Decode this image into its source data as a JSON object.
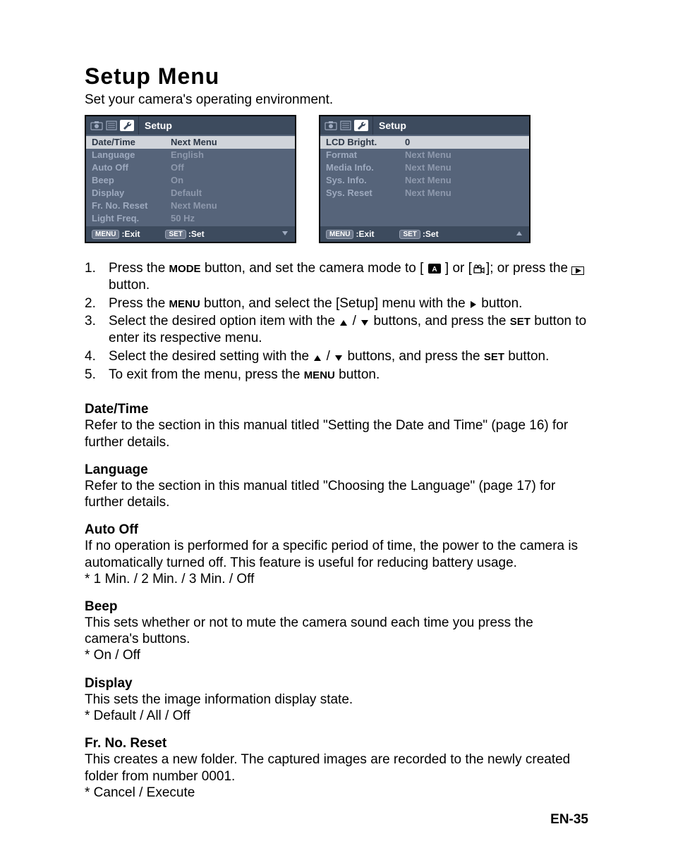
{
  "title": "Setup Menu",
  "intro": "Set your camera's operating environment.",
  "osd1": {
    "setup_label": "Setup",
    "rows": [
      {
        "label": "Date/Time",
        "value": "Next Menu",
        "highlight": true
      },
      {
        "label": "Language",
        "value": "English"
      },
      {
        "label": "Auto Off",
        "value": "Off"
      },
      {
        "label": "Beep",
        "value": "On"
      },
      {
        "label": "Display",
        "value": "Default"
      },
      {
        "label": "Fr. No. Reset",
        "value": "Next Menu"
      },
      {
        "label": "Light Freq.",
        "value": "50 Hz"
      }
    ],
    "footer_exit": ":Exit",
    "footer_set": ":Set",
    "btn_menu": "MENU",
    "btn_set": "SET"
  },
  "osd2": {
    "setup_label": "Setup",
    "rows": [
      {
        "label": "LCD Bright.",
        "value": "0",
        "highlight": true
      },
      {
        "label": "Format",
        "value": "Next Menu"
      },
      {
        "label": "Media Info.",
        "value": "Next Menu"
      },
      {
        "label": "Sys. Info.",
        "value": "Next Menu"
      },
      {
        "label": "Sys. Reset",
        "value": "Next Menu"
      }
    ],
    "footer_exit": ":Exit",
    "footer_set": ":Set",
    "btn_menu": "MENU",
    "btn_set": "SET"
  },
  "steps": {
    "n1": "1.",
    "s1a": "Press the ",
    "s1_mode": "MODE",
    "s1b": " button, and set the camera mode to [ ",
    "s1c": " ] or [",
    "s1d": "]; or press the ",
    "s1e": " button.",
    "n2": "2.",
    "s2a": "Press the ",
    "s2_menu": "MENU",
    "s2b": " button, and select the [Setup] menu with the ",
    "s2c": " button.",
    "n3": "3.",
    "s3a": "Select the desired option item with the ",
    "s3b": " / ",
    "s3c": " buttons, and press the ",
    "s3_set": "SET",
    "s3d": " button to enter its respective menu.",
    "n4": "4.",
    "s4a": "Select the desired setting with the ",
    "s4b": " / ",
    "s4c": " buttons, and press the ",
    "s4_set": "SET",
    "s4d": " button.",
    "n5": "5.",
    "s5a": "To exit from the menu, press the ",
    "s5_menu": "MENU",
    "s5b": " button."
  },
  "sections": {
    "datetime_h": "Date/Time",
    "datetime_b": "Refer to the section in this manual titled \"Setting the Date and Time\" (page 16) for further details.",
    "language_h": "Language",
    "language_b": "Refer to the section in this manual titled \"Choosing the Language\" (page 17) for further details.",
    "autooff_h": "Auto Off",
    "autooff_b1": "If no operation is performed for a specific period of time, the power to the camera is automatically turned off. This feature is useful for reducing battery usage.",
    "autooff_b2": "* 1 Min. / 2 Min. / 3 Min. / Off",
    "beep_h": "Beep",
    "beep_b1": "This sets whether or not to mute the camera sound each time you press the camera's buttons.",
    "beep_b2": "* On / Off",
    "display_h": "Display",
    "display_b1": "This sets the image information display state.",
    "display_b2": "* Default / All / Off",
    "frno_h": "Fr. No. Reset",
    "frno_b1": "This creates a new folder. The captured images are recorded to the newly created folder from number 0001.",
    "frno_b2": "* Cancel / Execute"
  },
  "page_number": "EN-35"
}
